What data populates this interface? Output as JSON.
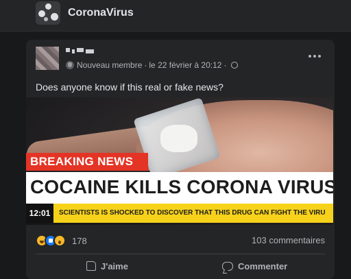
{
  "group": {
    "name": "CoronaVirus",
    "avatar_icon": "virus-group-avatar-icon"
  },
  "post": {
    "author_badge": "Nouveau membre",
    "separator": "·",
    "timestamp": "le 22 février à 20:12",
    "separator2": "·",
    "privacy_icon": "globe-icon",
    "text": "Does anyone know if this real or fake news?",
    "image": {
      "breaking_label": "BREAKING NEWS",
      "headline": "COCAINE KILLS CORONA VIRUS",
      "time": "12:01",
      "ticker": "SCIENTISTS IS SHOCKED TO DISCOVER THAT THIS DRUG CAN FIGHT THE VIRU"
    },
    "reactions": {
      "icons": [
        "haha-icon",
        "like-icon",
        "wow-icon"
      ],
      "count": "178"
    },
    "comments_count": "103 commentaires",
    "actions": {
      "like_label": "J'aime",
      "comment_label": "Commenter"
    }
  },
  "colors": {
    "background": "#18191a",
    "card": "#242526",
    "breaking_red": "#e43425",
    "ticker_yellow": "#f7d21a",
    "like_blue": "#1877f2"
  }
}
